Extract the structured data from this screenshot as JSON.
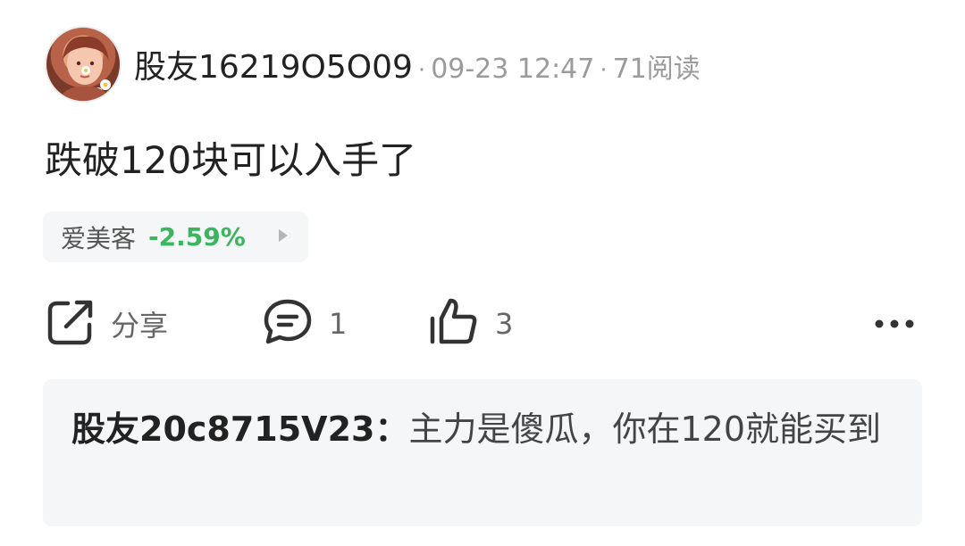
{
  "post": {
    "author": "股友16219O5O09",
    "separator": "·",
    "time": "09-23 12:47",
    "reads": "71阅读",
    "content": "跌破120块可以入手了"
  },
  "stock": {
    "name": "爱美客",
    "change": "-2.59%",
    "change_color": "#3bb55e"
  },
  "actions": {
    "share_label": "分享",
    "comment_count": "1",
    "like_count": "3"
  },
  "icons": {
    "share": "share-icon",
    "comment": "comment-icon",
    "like": "thumbs-up-icon",
    "more": "more-dots-icon",
    "arrow": "triangle-right-icon"
  },
  "comment_preview": {
    "user": "股友20c8715V23：",
    "text": "主力是傻瓜，你在120就能买到"
  }
}
